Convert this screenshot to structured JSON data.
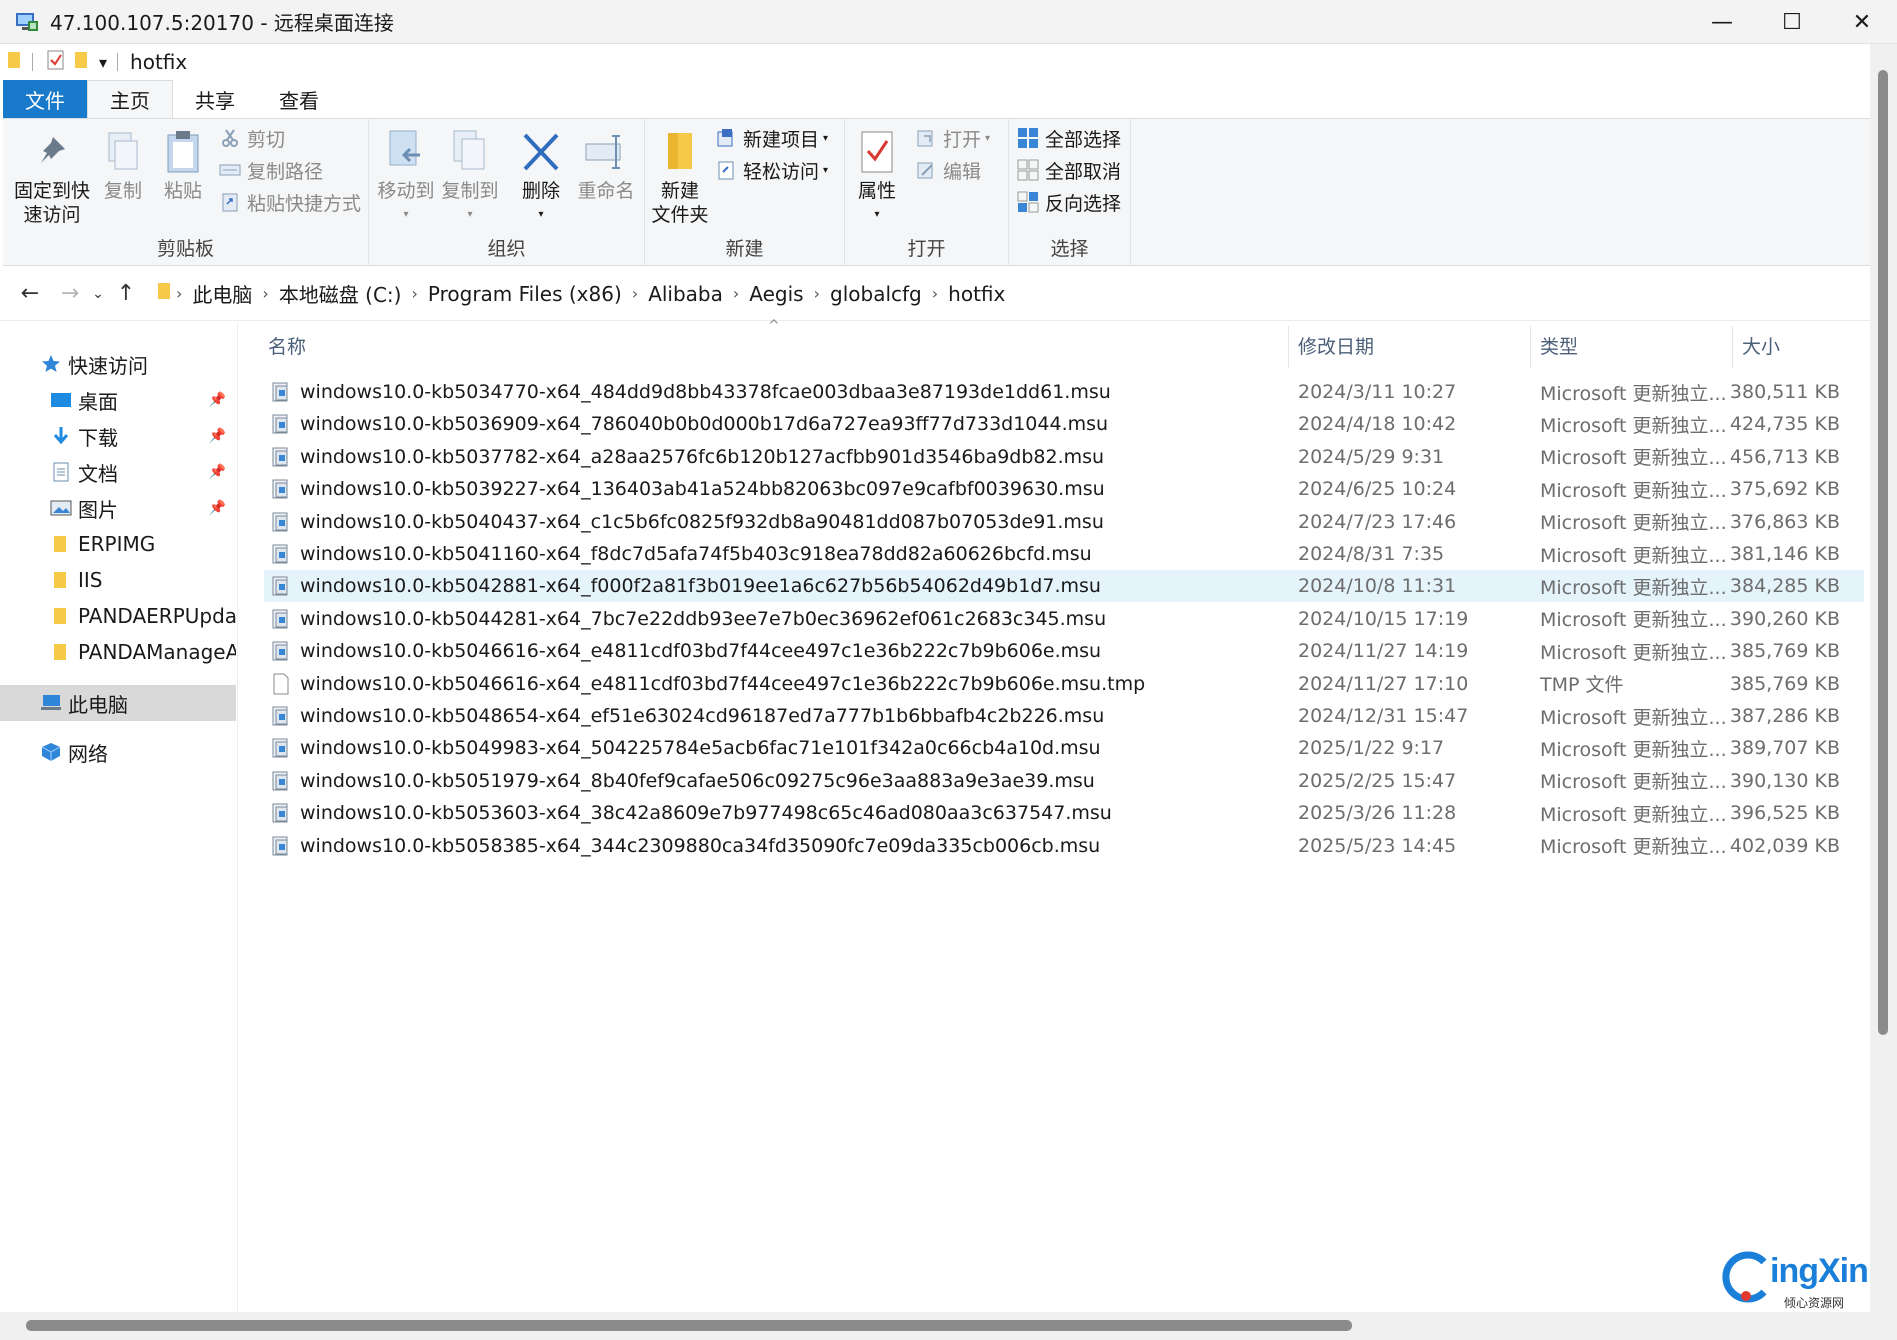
{
  "window": {
    "title": "47.100.107.5:20170 - 远程桌面连接",
    "minimize": "—",
    "maximize": "☐",
    "close": "✕"
  },
  "qat": {
    "path": "hotfix",
    "dropdown": "▾"
  },
  "tabs": [
    "文件",
    "主页",
    "共享",
    "查看"
  ],
  "ribbon": {
    "clipboard": {
      "label": "剪贴板",
      "pin": "固定到快\n速访问",
      "copy": "复制",
      "paste": "粘贴",
      "cut": "剪切",
      "copy_path": "复制路径",
      "paste_shortcut": "粘贴快捷方式"
    },
    "organize": {
      "label": "组织",
      "move_to": "移动到",
      "copy_to": "复制到",
      "delete": "删除",
      "rename": "重命名"
    },
    "new": {
      "label": "新建",
      "new_folder": "新建\n文件夹",
      "new_item": "新建项目",
      "easy_access": "轻松访问"
    },
    "open": {
      "label": "打开",
      "properties": "属性",
      "open": "打开",
      "edit": "编辑"
    },
    "select": {
      "label": "选择",
      "select_all": "全部选择",
      "select_none": "全部取消",
      "invert": "反向选择"
    }
  },
  "address": {
    "back": "←",
    "forward": "→",
    "recent": "⌄",
    "up": "↑",
    "crumbs": [
      "此电脑",
      "本地磁盘 (C:)",
      "Program Files (x86)",
      "Alibaba",
      "Aegis",
      "globalcfg",
      "hotfix"
    ]
  },
  "sidebar": {
    "quick_access": "快速访问",
    "items": [
      {
        "label": "桌面",
        "pinned": true
      },
      {
        "label": "下载",
        "pinned": true
      },
      {
        "label": "文档",
        "pinned": true
      },
      {
        "label": "图片",
        "pinned": true
      },
      {
        "label": "ERPIMG",
        "pinned": false
      },
      {
        "label": "IIS",
        "pinned": false
      },
      {
        "label": "PANDAERPUpdate",
        "pinned": false
      },
      {
        "label": "PANDAManageAp",
        "pinned": false
      }
    ],
    "this_pc": "此电脑",
    "network": "网络"
  },
  "columns": {
    "name": "名称",
    "date": "修改日期",
    "type": "类型",
    "size": "大小",
    "sort_indicator": "^"
  },
  "files": [
    {
      "name": "windows10.0-kb5034770-x64_484dd9d8bb43378fcae003dbaa3e87193de1dd61.msu",
      "date": "2024/3/11 10:27",
      "type": "Microsoft 更新独立...",
      "size": "380,511 KB",
      "icon": "msu"
    },
    {
      "name": "windows10.0-kb5036909-x64_786040b0b0d000b17d6a727ea93ff77d733d1044.msu",
      "date": "2024/4/18 10:42",
      "type": "Microsoft 更新独立...",
      "size": "424,735 KB",
      "icon": "msu"
    },
    {
      "name": "windows10.0-kb5037782-x64_a28aa2576fc6b120b127acfbb901d3546ba9db82.msu",
      "date": "2024/5/29 9:31",
      "type": "Microsoft 更新独立...",
      "size": "456,713 KB",
      "icon": "msu"
    },
    {
      "name": "windows10.0-kb5039227-x64_136403ab41a524bb82063bc097e9cafbf0039630.msu",
      "date": "2024/6/25 10:24",
      "type": "Microsoft 更新独立...",
      "size": "375,692 KB",
      "icon": "msu"
    },
    {
      "name": "windows10.0-kb5040437-x64_c1c5b6fc0825f932db8a90481dd087b07053de91.msu",
      "date": "2024/7/23 17:46",
      "type": "Microsoft 更新独立...",
      "size": "376,863 KB",
      "icon": "msu"
    },
    {
      "name": "windows10.0-kb5041160-x64_f8dc7d5afa74f5b403c918ea78dd82a60626bcfd.msu",
      "date": "2024/8/31 7:35",
      "type": "Microsoft 更新独立...",
      "size": "381,146 KB",
      "icon": "msu"
    },
    {
      "name": "windows10.0-kb5042881-x64_f000f2a81f3b019ee1a6c627b56b54062d49b1d7.msu",
      "date": "2024/10/8 11:31",
      "type": "Microsoft 更新独立...",
      "size": "384,285 KB",
      "icon": "msu",
      "selected": true
    },
    {
      "name": "windows10.0-kb5044281-x64_7bc7e22ddb93ee7e7b0ec36962ef061c2683c345.msu",
      "date": "2024/10/15 17:19",
      "type": "Microsoft 更新独立...",
      "size": "390,260 KB",
      "icon": "msu"
    },
    {
      "name": "windows10.0-kb5046616-x64_e4811cdf03bd7f44cee497c1e36b222c7b9b606e.msu",
      "date": "2024/11/27 14:19",
      "type": "Microsoft 更新独立...",
      "size": "385,769 KB",
      "icon": "msu"
    },
    {
      "name": "windows10.0-kb5046616-x64_e4811cdf03bd7f44cee497c1e36b222c7b9b606e.msu.tmp",
      "date": "2024/11/27 17:10",
      "type": "TMP 文件",
      "size": "385,769 KB",
      "icon": "blank"
    },
    {
      "name": "windows10.0-kb5048654-x64_ef51e63024cd96187ed7a777b1b6bbafb4c2b226.msu",
      "date": "2024/12/31 15:47",
      "type": "Microsoft 更新独立...",
      "size": "387,286 KB",
      "icon": "msu"
    },
    {
      "name": "windows10.0-kb5049983-x64_504225784e5acb6fac71e101f342a0c66cb4a10d.msu",
      "date": "2025/1/22 9:17",
      "type": "Microsoft 更新独立...",
      "size": "389,707 KB",
      "icon": "msu"
    },
    {
      "name": "windows10.0-kb5051979-x64_8b40fef9cafae506c09275c96e3aa883a9e3ae39.msu",
      "date": "2025/2/25 15:47",
      "type": "Microsoft 更新独立...",
      "size": "390,130 KB",
      "icon": "msu"
    },
    {
      "name": "windows10.0-kb5053603-x64_38c42a8609e7b977498c65c46ad080aa3c637547.msu",
      "date": "2025/3/26 11:28",
      "type": "Microsoft 更新独立...",
      "size": "396,525 KB",
      "icon": "msu"
    },
    {
      "name": "windows10.0-kb5058385-x64_344c2309880ca34fd35090fc7e09da335cb006cb.msu",
      "date": "2025/5/23 14:45",
      "type": "Microsoft 更新独立...",
      "size": "402,039 KB",
      "icon": "msu"
    }
  ],
  "watermark": {
    "text": "ingXin",
    "sub": "倾心资源网"
  },
  "colors": {
    "file_tab": "#1979ca",
    "selection": "#e5f3fb",
    "folder": "#f7c948",
    "accent_blue": "#1a7fd9"
  }
}
